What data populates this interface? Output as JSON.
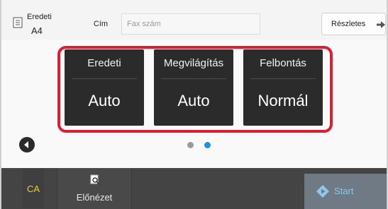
{
  "header": {
    "original_label": "Eredeti",
    "original_size": "A4",
    "address_button": "Cím",
    "fax_placeholder": "Fax szám",
    "details_button": "Részletes"
  },
  "settings": [
    {
      "title": "Eredeti",
      "value": "Auto"
    },
    {
      "title": "Megvilágítás",
      "value": "Auto"
    },
    {
      "title": "Felbontás",
      "value": "Normál"
    }
  ],
  "pagination": {
    "pages": 2,
    "active_page": 2
  },
  "footer": {
    "ca_button": "CA",
    "preview_button": "Előnézet",
    "start_button": "Start"
  },
  "colors": {
    "highlight": "#de1c33",
    "tile": "#2b2b2b",
    "ca_text": "#f0d21a",
    "active_dot": "#1f8fe0",
    "inactive_dot": "#9a9a9a",
    "start_bg": "#6f7a85",
    "start_text": "#8fc6ea"
  },
  "icons": {
    "original": "document-icon",
    "details_arrow": "arrow-right-icon",
    "back": "chevron-left-icon",
    "preview": "magnifier-page-icon",
    "start": "diamond-start-icon"
  }
}
